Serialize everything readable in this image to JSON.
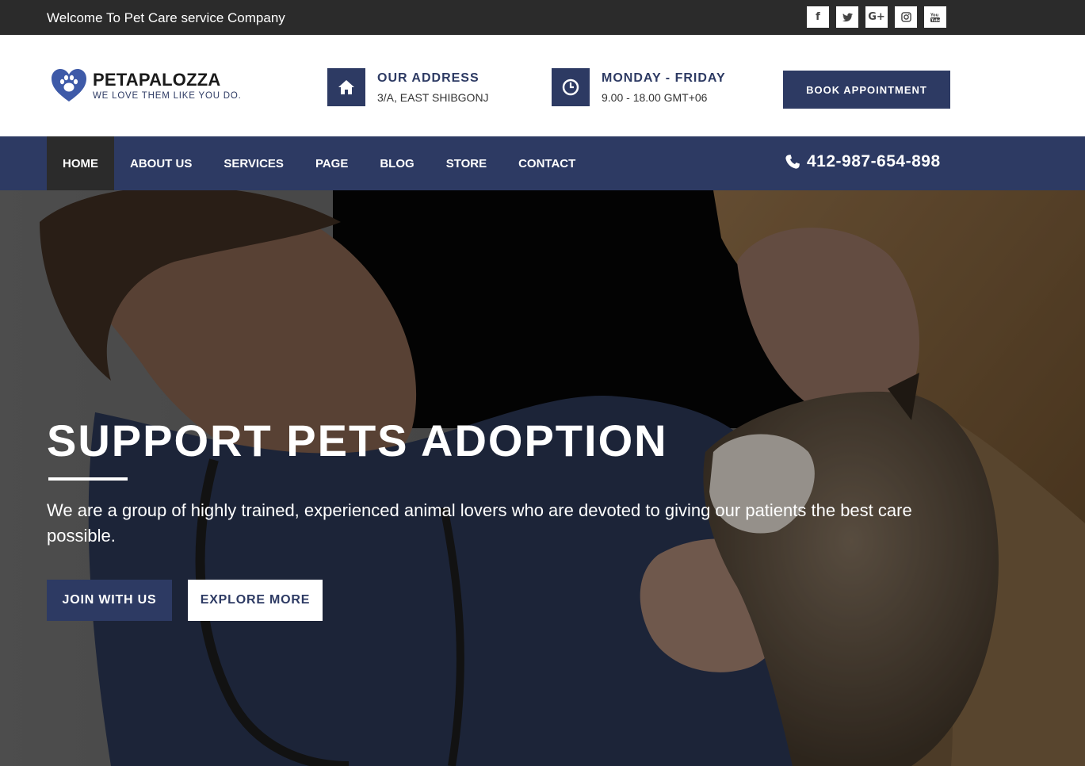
{
  "topbar": {
    "welcome": "Welcome To Pet Care service Company",
    "social": [
      {
        "icon": "facebook-icon",
        "glyph": "f"
      },
      {
        "icon": "twitter-icon",
        "glyph": "t"
      },
      {
        "icon": "google-plus-icon",
        "glyph": "G+"
      },
      {
        "icon": "instagram-icon",
        "glyph": "◎"
      },
      {
        "icon": "youtube-icon",
        "glyph": "▶"
      }
    ]
  },
  "header": {
    "logo_name": "PETAPALOZZA",
    "logo_tagline": "WE LOVE THEM LIKE YOU DO.",
    "address": {
      "title": "OUR ADDRESS",
      "value": "3/A, EAST SHIBGONJ",
      "icon": "home-icon"
    },
    "hours": {
      "title": "MONDAY - FRIDAY",
      "value": "9.00 - 18.00 GMT+06",
      "icon": "clock-icon"
    },
    "book_button": "BOOK APPOINTMENT"
  },
  "nav": {
    "items": [
      "HOME",
      "ABOUT US",
      "SERVICES",
      "PAGE",
      "BLOG",
      "STORE",
      "CONTACT"
    ],
    "active": "HOME",
    "phone": "412-987-654-898",
    "phone_icon": "phone-icon"
  },
  "hero": {
    "title": "SUPPORT PETS ADOPTION",
    "description": "We are a group of highly trained, experienced animal lovers who are devoted to giving our patients the best care possible.",
    "primary_button": "JOIN WITH US",
    "secondary_button": "EXPLORE MORE"
  },
  "colors": {
    "primary": "#2d3a63",
    "topbar": "#2b2b2b",
    "white": "#ffffff"
  }
}
